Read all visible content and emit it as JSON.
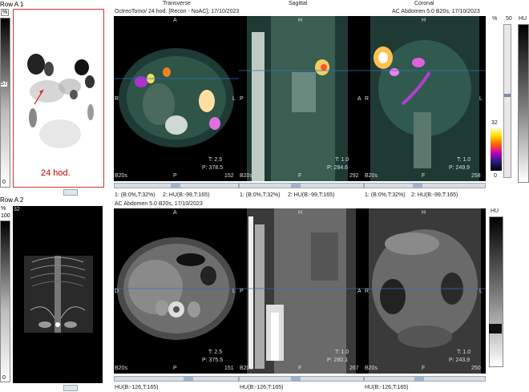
{
  "rowA1": {
    "label": "Row A 1",
    "pct": "%",
    "num": "32",
    "scale_mid": "57",
    "scale_bottom": "0",
    "mip_caption": "24 hod."
  },
  "rowA2": {
    "label": "Row A 2",
    "pct": "%",
    "top": "100",
    "num": "32",
    "scale_bottom": "0"
  },
  "views": {
    "transverse": "Transverse",
    "sagittal": "Sagittal",
    "coronal": "Coronal"
  },
  "top_header": {
    "left": "OctreoTomo/ 24 hod. [Recon - NoAC]; 17/10/2023",
    "right": "AC Abdomen  5.0  B20s, 17/10/2023"
  },
  "bottom_header": {
    "left": "AC Abdomen  5.0  B20s, 17/10/2023"
  },
  "top_panels": [
    {
      "A": "A",
      "P": "P",
      "R": "R",
      "L": "L",
      "t": "T: 2.5",
      "p": "P: 378.5",
      "num": "152",
      "b": "B20s"
    },
    {
      "A": "H",
      "P": "F",
      "R": "A",
      "L": "P",
      "t": "T: 1.0",
      "p": "P: 284.6",
      "num": "292",
      "b": "B20s"
    },
    {
      "A": "H",
      "P": "F",
      "R": "R",
      "L": "L",
      "t": "T: 1.0",
      "p": "P: 249.9",
      "num": "258",
      "b": "B20s"
    }
  ],
  "bottom_panels": [
    {
      "A": "A",
      "P": "P",
      "R": "D",
      "L": "L",
      "t": "T: 2.5",
      "p": "P: 375.5",
      "num": "151",
      "b": "B20s"
    },
    {
      "A": "H",
      "P": "F",
      "R": "A",
      "L": "P",
      "t": "T: 1.0",
      "p": "P: 280.1",
      "num": "267",
      "b": "B20s"
    },
    {
      "A": "H",
      "P": "F",
      "R": "R",
      "L": "L",
      "t": "T: 1.0",
      "p": "P: 243.9",
      "num": "250",
      "b": "B20s"
    }
  ],
  "status_top": [
    {
      "a": "1: (B:0%,T:32%)",
      "b": "2: HU(B:-99,T:165)"
    },
    {
      "a": "1: (B:0%,T:32%)",
      "b": "2: HU(B:-99,T:165)"
    },
    {
      "a": "1: (B:0%,T:32%)",
      "b": "2: HU(B:-99,T:165)"
    }
  ],
  "status_bottom": [
    "HU(B:-126,T:165)",
    "HU(B:-126,T:165)",
    "HU(B:-126,T:165)"
  ],
  "right_top": {
    "pct": "%",
    "val50": "50",
    "hu": "HU",
    "val32": "32",
    "val0": "0"
  },
  "right_bottom": {
    "hu": "HU"
  }
}
